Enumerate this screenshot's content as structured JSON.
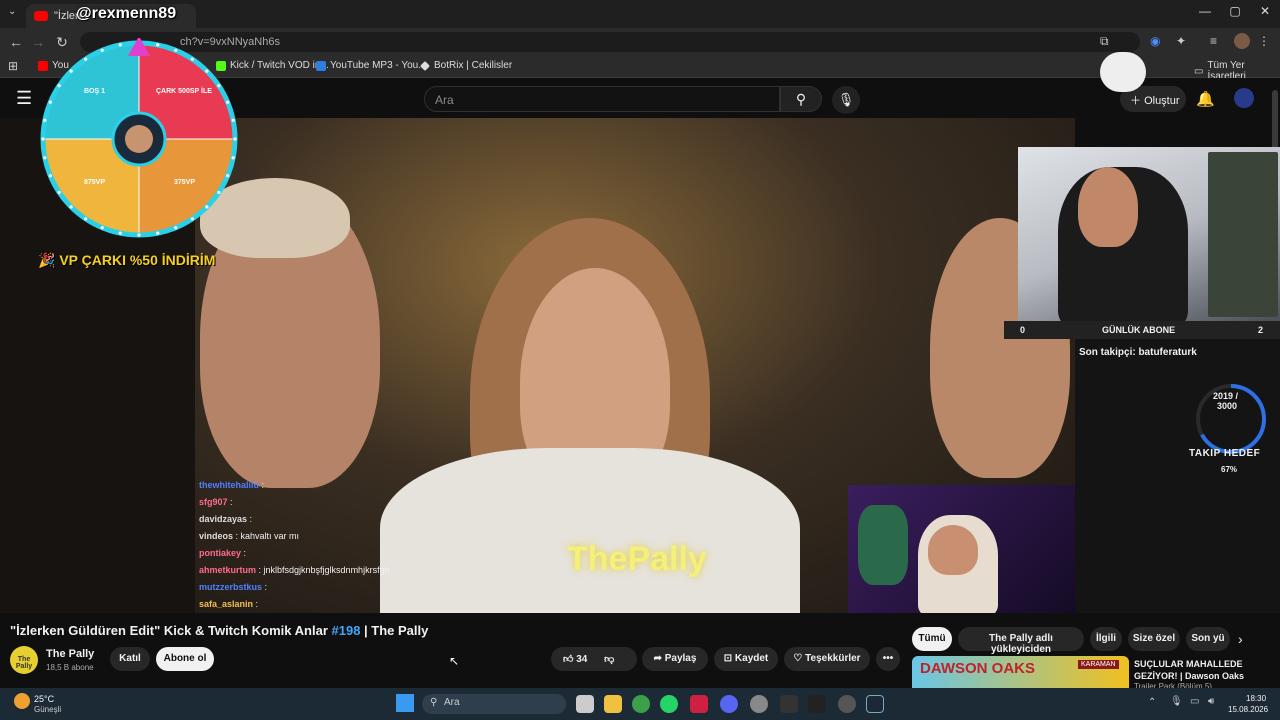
{
  "browser": {
    "tab_title": "\"İzlerke",
    "handle_overlay": "@rexmenn89",
    "url": "ch?v=9vxNNyaNh6s",
    "bookmarks": [
      {
        "label": "You",
        "color": "#ff0000"
      },
      {
        "label": "Kick / Twitch VOD in...",
        "color": "#53fc18"
      },
      {
        "label": "YouTube MP3 - You...",
        "color": "#2f7de1"
      },
      {
        "label": "BotRix | Cekilisler",
        "color": "#dddddd"
      }
    ],
    "all_bookmarks": "Tüm Yer İşaretleri",
    "window_controls": [
      "—",
      "▢",
      "✕"
    ]
  },
  "youtube": {
    "search_placeholder": "Ara",
    "create_label": "Oluştur",
    "video_title_pre": "\"İzlerken Güldüren Edit\" Kick & Twitch Komik Anlar ",
    "video_tag": "#198",
    "video_title_post": " | The Pally",
    "channel_name": "The Pally",
    "subscribers": "18,5 B abone",
    "join_label": "Katıl",
    "subscribe_label": "Abone ol",
    "like_count": "34",
    "share_label": "Paylaş",
    "save_label": "Kaydet",
    "thanks_label": "Teşekkürler",
    "more_label": "•••",
    "filter_chips": [
      "Tümü",
      "The Pally adlı yükleyiciden",
      "İlgili",
      "Size özel",
      "Son yü"
    ],
    "rec_title": "SUÇLULAR MAHALLEDE GEZİYOR! | Dawson Oaks",
    "rec_sub": "Trailer Park (Bölüm 5)",
    "rec_thumb_text": "DAWSON OAKS",
    "rec_badge": "KARAMAN"
  },
  "stream": {
    "wheel_labels": [
      "BOŞ 1",
      "ÇARK 500SP İLE",
      "875VP",
      "375VP"
    ],
    "wheel_colors": [
      "#2ec4d6",
      "#e83a52",
      "#f0b53c",
      "#e8963a"
    ],
    "wheel_promo": "🎉 VP ÇARKI %50 İNDİRİM",
    "overlay_name": "ThePally",
    "chat": [
      {
        "user": "thewhitehalilu",
        "msg": ":",
        "color": "#4f7fff"
      },
      {
        "user": "sfg907",
        "msg": ":",
        "color": "#ff6b8b"
      },
      {
        "user": "davidzayas",
        "msg": ":",
        "color": "#dddddd"
      },
      {
        "user": "vindeos",
        "msg": ": kahvaltı var mı",
        "color": "#dddddd"
      },
      {
        "user": "pontiakey",
        "msg": ":",
        "color": "#ff6b8b"
      },
      {
        "user": "ahmetkurtum",
        "msg": ": jnklbfsdgjknbşfjglksdnmhjkrsfgh",
        "color": "#ff6b8b"
      },
      {
        "user": "mutzzerbstkus",
        "msg": ":",
        "color": "#4f7fff"
      },
      {
        "user": "safa_aslanin",
        "msg": ":",
        "color": "#f0c050"
      }
    ],
    "daily_sub_label": "GÜNLÜK ABONE",
    "daily_sub_left": "0",
    "daily_sub_right": "2",
    "last_follower": "Son takipçi: batuferaturk",
    "goal_current": "2019 /",
    "goal_total": "3000",
    "goal_label": "TAKIP HEDEF",
    "goal_pct_text": "67%",
    "goal_fraction": 0.67
  },
  "taskbar": {
    "weather_temp": "25°C",
    "weather_desc": "Güneşli",
    "search_placeholder": "Ara",
    "time": "18:30",
    "date": "15.08.2026"
  }
}
